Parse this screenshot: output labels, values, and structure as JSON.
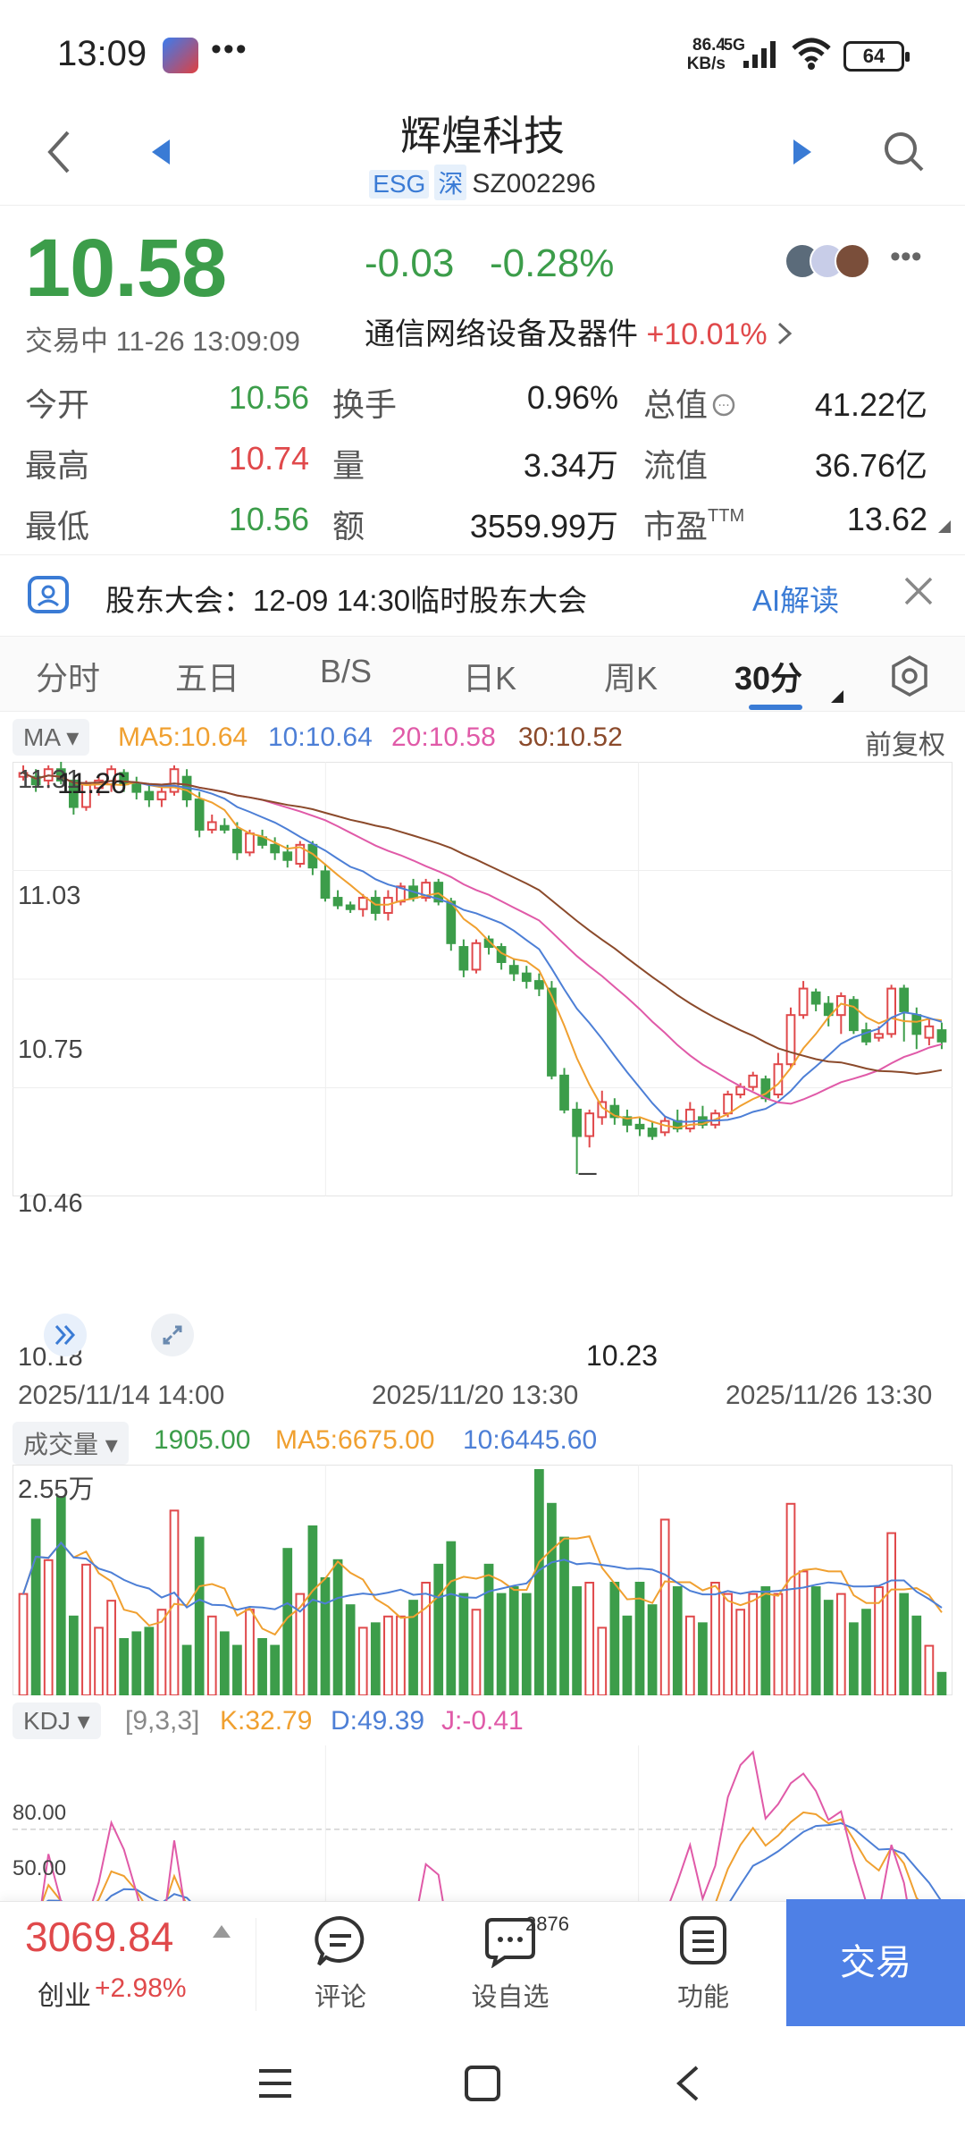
{
  "status_bar": {
    "time": "13:09",
    "dots": "•••",
    "speed_value": "86.4",
    "speed_unit": "KB/s",
    "network": "5G",
    "battery": "64"
  },
  "header": {
    "title": "辉煌科技",
    "tag_esg": "ESG",
    "tag_market": "深",
    "code": "SZ002296"
  },
  "quote": {
    "price": "10.58",
    "change": "-0.03",
    "change_pct": "-0.28%",
    "status": "交易中 11-26 13:09:09",
    "industry_name": "通信网络设备及器件",
    "industry_change": "+10.01%",
    "more": "•••"
  },
  "stats": [
    {
      "label": "今开",
      "value": "10.56",
      "color": "#3c9d4a"
    },
    {
      "label": "最高",
      "value": "10.74",
      "color": "#e0494b"
    },
    {
      "label": "最低",
      "value": "10.56",
      "color": "#3c9d4a"
    },
    {
      "label": "换手",
      "value": "0.96%",
      "color": "#222222"
    },
    {
      "label": "量",
      "value": "3.34万",
      "color": "#222222"
    },
    {
      "label": "额",
      "value": "3559.99万",
      "color": "#222222"
    },
    {
      "label": "总值",
      "value": "41.22亿",
      "color": "#222222"
    },
    {
      "label": "流值",
      "value": "36.76亿",
      "color": "#222222"
    },
    {
      "label": "市盈",
      "label_sup": "TTM",
      "value": "13.62",
      "color": "#222222"
    }
  ],
  "notice": {
    "text": "股东大会：12-09 14:30临时股东大会",
    "ai_label": "AI解读"
  },
  "tabs": [
    "分时",
    "五日",
    "B/S",
    "日K",
    "周K",
    "30分"
  ],
  "active_tab": "30分",
  "chart_legend": {
    "ma_selector": "MA",
    "ma5": "MA5:10.64",
    "ma10": "10:10.64",
    "ma20": "20:10.58",
    "ma30": "30:10.52",
    "adjust": "前复权",
    "vol_selector": "成交量",
    "vol_value": "1905.00",
    "vol_ma5": "MA5:6675.00",
    "vol_ma10": "10:6445.60",
    "vol_max": "2.55万",
    "kdj_selector": "KDJ",
    "kdj_params": "[9,3,3]",
    "kdj_k": "K:32.79",
    "kdj_d": "D:49.39",
    "kdj_j": "J:-0.41"
  },
  "chart_data": {
    "type": "candlestick",
    "price_axis": [
      "11.31",
      "11.03",
      "10.75",
      "10.46",
      "10.18"
    ],
    "y_range": [
      10.18,
      11.31
    ],
    "max_label": "11.26",
    "min_label": "10.23",
    "date_labels": [
      "2025/11/14 14:00",
      "2025/11/20 13:30",
      "2025/11/26 13:30"
    ],
    "kdj_axis": [
      "80.00",
      "50.00"
    ],
    "candles": [
      [
        11.28,
        11.29,
        11.31,
        11.27
      ],
      [
        11.28,
        11.26,
        11.3,
        11.24
      ],
      [
        11.27,
        11.3,
        11.31,
        11.25
      ],
      [
        11.3,
        11.27,
        11.32,
        11.26
      ],
      [
        11.27,
        11.2,
        11.28,
        11.18
      ],
      [
        11.2,
        11.26,
        11.27,
        11.19
      ],
      [
        11.25,
        11.27,
        11.28,
        11.23
      ],
      [
        11.26,
        11.3,
        11.31,
        11.24
      ],
      [
        11.29,
        11.26,
        11.3,
        11.24
      ],
      [
        11.26,
        11.24,
        11.28,
        11.22
      ],
      [
        11.24,
        11.22,
        11.26,
        11.2
      ],
      [
        11.22,
        11.24,
        11.26,
        11.2
      ],
      [
        11.24,
        11.3,
        11.31,
        11.23
      ],
      [
        11.28,
        11.22,
        11.3,
        11.2
      ],
      [
        11.22,
        11.14,
        11.24,
        11.12
      ],
      [
        11.14,
        11.16,
        11.18,
        11.13
      ],
      [
        11.15,
        11.14,
        11.17,
        11.13
      ],
      [
        11.14,
        11.08,
        11.16,
        11.06
      ],
      [
        11.08,
        11.13,
        11.14,
        11.07
      ],
      [
        11.12,
        11.1,
        11.14,
        11.09
      ],
      [
        11.1,
        11.08,
        11.12,
        11.06
      ],
      [
        11.08,
        11.06,
        11.1,
        11.04
      ],
      [
        11.05,
        11.1,
        11.11,
        11.04
      ],
      [
        11.1,
        11.04,
        11.11,
        11.02
      ],
      [
        11.03,
        10.96,
        11.05,
        10.95
      ],
      [
        10.96,
        10.94,
        10.98,
        10.93
      ],
      [
        10.94,
        10.93,
        10.95,
        10.92
      ],
      [
        10.93,
        10.96,
        10.97,
        10.91
      ],
      [
        10.96,
        10.92,
        10.98,
        10.9
      ],
      [
        10.92,
        10.96,
        10.98,
        10.9
      ],
      [
        10.95,
        10.99,
        11.0,
        10.94
      ],
      [
        10.99,
        10.96,
        11.01,
        10.95
      ],
      [
        10.96,
        11.0,
        11.01,
        10.95
      ],
      [
        11.0,
        10.95,
        11.01,
        10.94
      ],
      [
        10.95,
        10.84,
        10.96,
        10.82
      ],
      [
        10.83,
        10.77,
        10.85,
        10.75
      ],
      [
        10.77,
        10.84,
        10.85,
        10.76
      ],
      [
        10.85,
        10.83,
        10.86,
        10.81
      ],
      [
        10.83,
        10.79,
        10.84,
        10.77
      ],
      [
        10.78,
        10.76,
        10.8,
        10.74
      ],
      [
        10.76,
        10.74,
        10.78,
        10.72
      ],
      [
        10.74,
        10.72,
        10.76,
        10.7
      ],
      [
        10.72,
        10.49,
        10.74,
        10.48
      ],
      [
        10.49,
        10.4,
        10.51,
        10.39
      ],
      [
        10.4,
        10.33,
        10.42,
        10.23
      ],
      [
        10.33,
        10.39,
        10.4,
        10.3
      ],
      [
        10.38,
        10.42,
        10.45,
        10.36
      ],
      [
        10.41,
        10.38,
        10.43,
        10.36
      ],
      [
        10.38,
        10.36,
        10.4,
        10.34
      ],
      [
        10.36,
        10.35,
        10.38,
        10.33
      ],
      [
        10.35,
        10.33,
        10.37,
        10.32
      ],
      [
        10.34,
        10.37,
        10.38,
        10.33
      ],
      [
        10.37,
        10.35,
        10.4,
        10.34
      ],
      [
        10.35,
        10.4,
        10.42,
        10.34
      ],
      [
        10.38,
        10.36,
        10.41,
        10.35
      ],
      [
        10.36,
        10.39,
        10.4,
        10.35
      ],
      [
        10.39,
        10.44,
        10.45,
        10.38
      ],
      [
        10.44,
        10.46,
        10.47,
        10.43
      ],
      [
        10.46,
        10.49,
        10.5,
        10.45
      ],
      [
        10.48,
        10.43,
        10.49,
        10.42
      ],
      [
        10.44,
        10.52,
        10.55,
        10.43
      ],
      [
        10.52,
        10.65,
        10.67,
        10.51
      ],
      [
        10.65,
        10.72,
        10.74,
        10.64
      ],
      [
        10.71,
        10.68,
        10.72,
        10.66
      ],
      [
        10.68,
        10.65,
        10.7,
        10.62
      ],
      [
        10.65,
        10.7,
        10.71,
        10.6
      ],
      [
        10.69,
        10.61,
        10.7,
        10.6
      ],
      [
        10.61,
        10.58,
        10.63,
        10.57
      ],
      [
        10.59,
        10.6,
        10.62,
        10.58
      ],
      [
        10.6,
        10.72,
        10.73,
        10.59
      ],
      [
        10.72,
        10.66,
        10.73,
        10.58
      ],
      [
        10.65,
        10.6,
        10.67,
        10.56
      ],
      [
        10.59,
        10.62,
        10.64,
        10.57
      ],
      [
        10.61,
        10.58,
        10.63,
        10.56
      ]
    ],
    "volume_max": 25500,
    "volume_levels": [
      0.45,
      0.78,
      0.6,
      0.88,
      0.35,
      0.58,
      0.3,
      0.42,
      0.25,
      0.28,
      0.3,
      0.38,
      0.82,
      0.22,
      0.7,
      0.35,
      0.28,
      0.22,
      0.38,
      0.25,
      0.22,
      0.65,
      0.45,
      0.75,
      0.52,
      0.6,
      0.4,
      0.3,
      0.32,
      0.35,
      0.35,
      0.42,
      0.5,
      0.58,
      0.68,
      0.45,
      0.38,
      0.58,
      0.45,
      0.48,
      0.45,
      1.0,
      0.85,
      0.7,
      0.48,
      0.5,
      0.3,
      0.5,
      0.35,
      0.5,
      0.4,
      0.78,
      0.48,
      0.35,
      0.32,
      0.5,
      0.45,
      0.38,
      0.45,
      0.48,
      0.45,
      0.85,
      0.55,
      0.48,
      0.42,
      0.45,
      0.32,
      0.38,
      0.48,
      0.72,
      0.45,
      0.35,
      0.22,
      0.1
    ]
  },
  "bottom_bar": {
    "index_value": "3069.84",
    "index_name": "创业",
    "index_change": "+2.98%",
    "comment": "评论",
    "watchlist": "设自选",
    "watchlist_badge": "2876",
    "functions": "功能",
    "trade": "交易"
  },
  "colors": {
    "up": "#e0494b",
    "down": "#3c9d4a",
    "ma5": "#f0a030",
    "ma10": "#4d7fd6",
    "ma20": "#e05aa8",
    "ma30": "#8b4a2b",
    "accent": "#3a7bd5",
    "trade_button": "#4e80e6"
  }
}
